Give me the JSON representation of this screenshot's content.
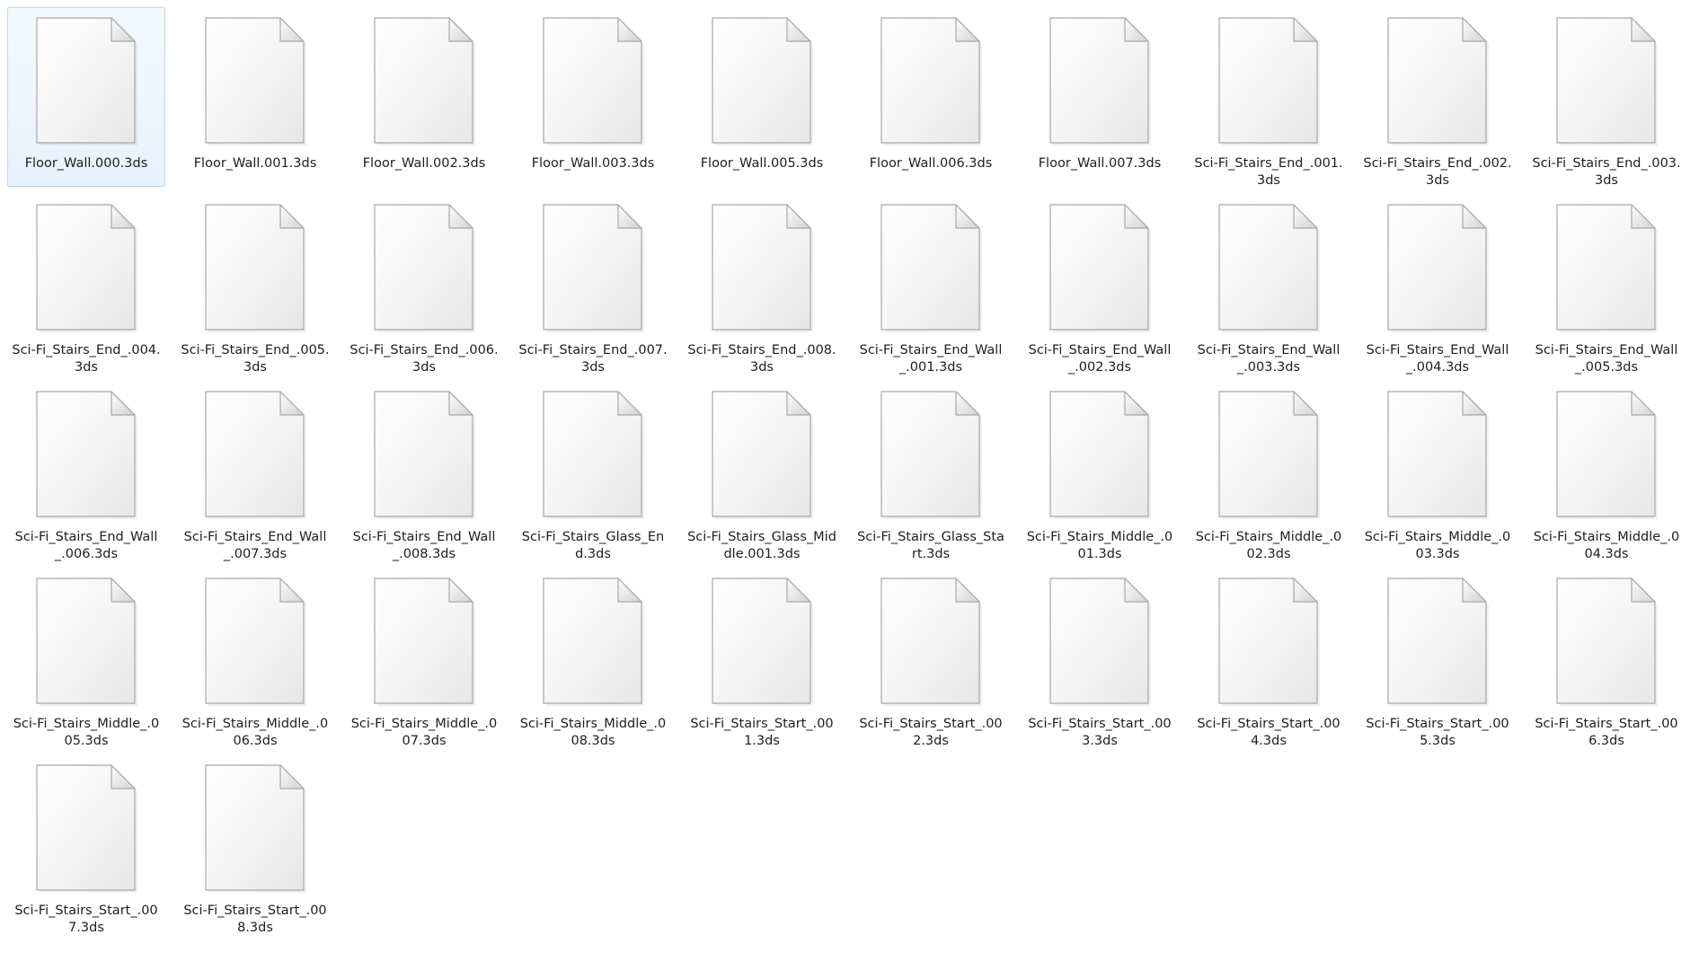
{
  "window": {
    "view": "large-icons"
  },
  "colors": {
    "selection_bg": "#e7f2fd",
    "selection_border": "#bcd9f3",
    "text": "#1e1e1e"
  },
  "icons": {
    "file": "generic-document-icon"
  },
  "files": [
    {
      "name": "Floor_Wall.000.3ds",
      "selected": true
    },
    {
      "name": "Floor_Wall.001.3ds"
    },
    {
      "name": "Floor_Wall.002.3ds"
    },
    {
      "name": "Floor_Wall.003.3ds"
    },
    {
      "name": "Floor_Wall.005.3ds"
    },
    {
      "name": "Floor_Wall.006.3ds"
    },
    {
      "name": "Floor_Wall.007.3ds"
    },
    {
      "name": "Sci-Fi_Stairs_End_.001.3ds"
    },
    {
      "name": "Sci-Fi_Stairs_End_.002.3ds"
    },
    {
      "name": "Sci-Fi_Stairs_End_.003.3ds"
    },
    {
      "name": "Sci-Fi_Stairs_End_.004.3ds"
    },
    {
      "name": "Sci-Fi_Stairs_End_.005.3ds"
    },
    {
      "name": "Sci-Fi_Stairs_End_.006.3ds"
    },
    {
      "name": "Sci-Fi_Stairs_End_.007.3ds"
    },
    {
      "name": "Sci-Fi_Stairs_End_.008.3ds"
    },
    {
      "name": "Sci-Fi_Stairs_End_Wall_.001.3ds"
    },
    {
      "name": "Sci-Fi_Stairs_End_Wall_.002.3ds"
    },
    {
      "name": "Sci-Fi_Stairs_End_Wall_.003.3ds"
    },
    {
      "name": "Sci-Fi_Stairs_End_Wall_.004.3ds"
    },
    {
      "name": "Sci-Fi_Stairs_End_Wall_.005.3ds"
    },
    {
      "name": "Sci-Fi_Stairs_End_Wall_.006.3ds"
    },
    {
      "name": "Sci-Fi_Stairs_End_Wall_.007.3ds"
    },
    {
      "name": "Sci-Fi_Stairs_End_Wall_.008.3ds"
    },
    {
      "name": "Sci-Fi_Stairs_Glass_End.3ds"
    },
    {
      "name": "Sci-Fi_Stairs_Glass_Middle.001.3ds"
    },
    {
      "name": "Sci-Fi_Stairs_Glass_Start.3ds"
    },
    {
      "name": "Sci-Fi_Stairs_Middle_.001.3ds"
    },
    {
      "name": "Sci-Fi_Stairs_Middle_.002.3ds"
    },
    {
      "name": "Sci-Fi_Stairs_Middle_.003.3ds"
    },
    {
      "name": "Sci-Fi_Stairs_Middle_.004.3ds"
    },
    {
      "name": "Sci-Fi_Stairs_Middle_.005.3ds"
    },
    {
      "name": "Sci-Fi_Stairs_Middle_.006.3ds"
    },
    {
      "name": "Sci-Fi_Stairs_Middle_.007.3ds"
    },
    {
      "name": "Sci-Fi_Stairs_Middle_.008.3ds"
    },
    {
      "name": "Sci-Fi_Stairs_Start_.001.3ds"
    },
    {
      "name": "Sci-Fi_Stairs_Start_.002.3ds"
    },
    {
      "name": "Sci-Fi_Stairs_Start_.003.3ds"
    },
    {
      "name": "Sci-Fi_Stairs_Start_.004.3ds"
    },
    {
      "name": "Sci-Fi_Stairs_Start_.005.3ds"
    },
    {
      "name": "Sci-Fi_Stairs_Start_.006.3ds"
    },
    {
      "name": "Sci-Fi_Stairs_Start_.007.3ds"
    },
    {
      "name": "Sci-Fi_Stairs_Start_.008.3ds"
    }
  ]
}
